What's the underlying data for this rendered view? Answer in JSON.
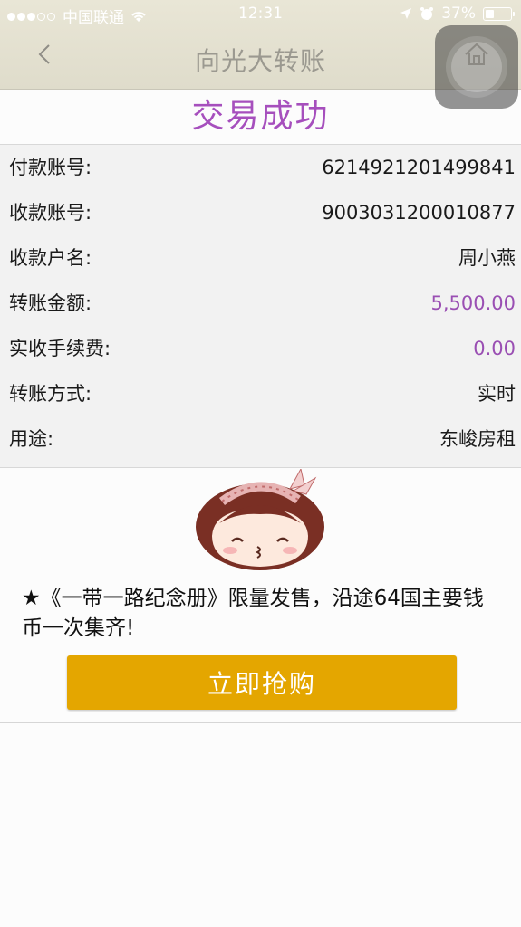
{
  "status_bar": {
    "carrier": "中国联通",
    "time": "12:31",
    "battery": "37%"
  },
  "nav": {
    "title": "向光大转账"
  },
  "result_title": "交易成功",
  "details": [
    {
      "label": "付款账号:",
      "value": "6214921201499841"
    },
    {
      "label": "收款账号:",
      "value": "9003031200010877"
    },
    {
      "label": "收款户名:",
      "value": "周小燕"
    },
    {
      "label": "转账金额:",
      "value": "5,500.00"
    },
    {
      "label": "实收手续费:",
      "value": "0.00"
    },
    {
      "label": "转账方式:",
      "value": "实时"
    },
    {
      "label": "用途:",
      "value": "东峻房租"
    }
  ],
  "promo": {
    "text": "★《一带一路纪念册》限量发售，沿途64国主要钱币一次集齐!",
    "button_label": "立即抢购"
  },
  "colors": {
    "accent_purple": "#a64fbd",
    "button_gold": "#e4a600"
  }
}
